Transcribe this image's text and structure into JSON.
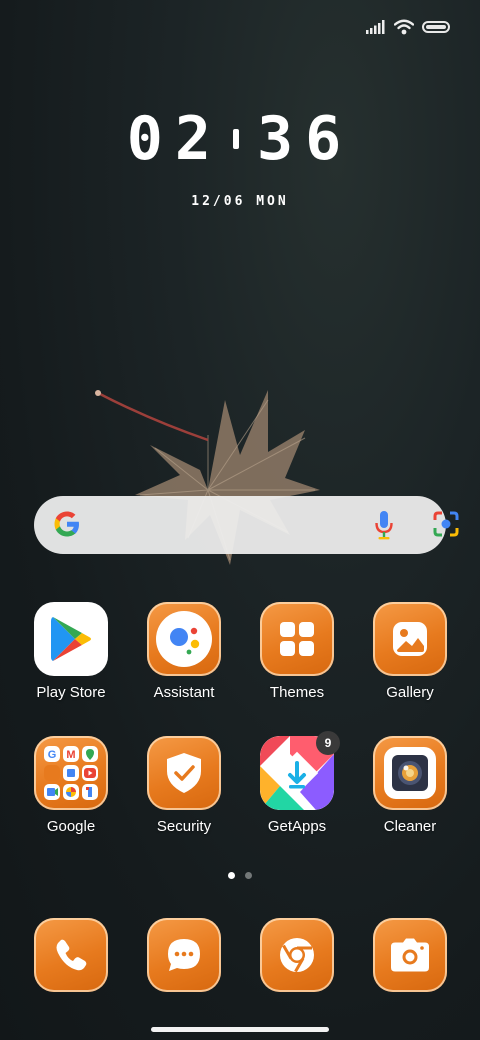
{
  "status_bar": {
    "icons": [
      "signal-icon",
      "wifi-icon",
      "battery-icon"
    ]
  },
  "clock": {
    "hours": "02",
    "minutes": "36"
  },
  "date": {
    "text": "12/06 MON"
  },
  "search": {
    "icons": [
      "google-g-icon",
      "mic-icon",
      "lens-icon"
    ]
  },
  "apps": {
    "row1": [
      {
        "label": "Play Store",
        "icon": "play-store-icon"
      },
      {
        "label": "Assistant",
        "icon": "assistant-icon"
      },
      {
        "label": "Themes",
        "icon": "themes-icon"
      },
      {
        "label": "Gallery",
        "icon": "gallery-icon"
      }
    ],
    "row2": [
      {
        "label": "Google",
        "icon": "google-folder-icon"
      },
      {
        "label": "Security",
        "icon": "security-icon"
      },
      {
        "label": "GetApps",
        "icon": "getapps-icon",
        "badge": "9"
      },
      {
        "label": "Cleaner",
        "icon": "cleaner-icon"
      }
    ]
  },
  "dock": [
    {
      "icon": "phone-icon"
    },
    {
      "icon": "messages-icon"
    },
    {
      "icon": "chrome-icon"
    },
    {
      "icon": "camera-icon"
    }
  ],
  "page_indicator": {
    "pages": 2,
    "current": 1
  },
  "colors": {
    "accent_orange": "#e8802a",
    "icon_border": "#ffe1be"
  }
}
